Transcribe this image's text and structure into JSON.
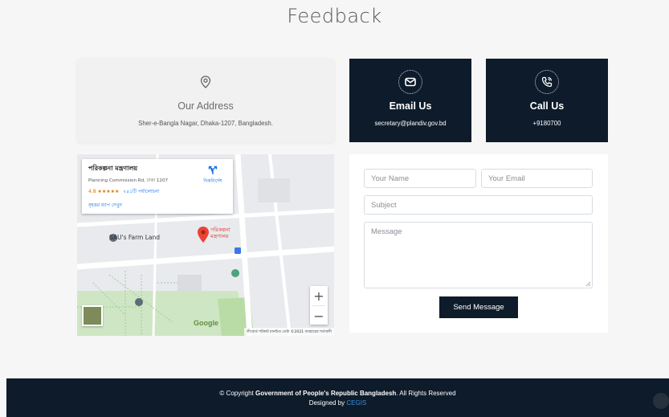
{
  "page": {
    "title": "Feedback"
  },
  "cards": {
    "address": {
      "title": "Our Address",
      "text": "Sher-e-Bangla Nagar, Dhaka-1207, Bangladesh.",
      "icon": "location-icon"
    },
    "email": {
      "title": "Email Us",
      "text": "secretary@plandiv.gov.bd",
      "icon": "envelope-icon"
    },
    "call": {
      "title": "Call Us",
      "text": "+9180700",
      "icon": "phone-icon"
    }
  },
  "map": {
    "place_name": "পরিকল্পনা মন্ত্রণালয়",
    "place_address": "Planning Commission Rd, ঢাকা 1207",
    "rating": "4.8",
    "stars": "★★★★★",
    "reviews": "২৪১টি পর্যালোচনা",
    "bigger_map": "বৃহত্তর ম্যাপ দেখুন",
    "directions": "দিকনির্দেশ",
    "pin_label": "পরিকল্পনা মন্ত্রণালয়",
    "farm_label": "SAU's Farm Land",
    "zoom_in": "+",
    "zoom_out": "−",
    "google": "Google",
    "attribution": "কীবোর্ড শর্টকাট   মানচিত্র ডেটা ©2021   ব্যবহারের শর্তাবলী"
  },
  "form": {
    "name_placeholder": "Your Name",
    "email_placeholder": "Your Email",
    "subject_placeholder": "Subject",
    "message_placeholder": "Message",
    "send_label": "Send Message"
  },
  "footer": {
    "copyright_prefix": "© Copyright",
    "org": "Government of People's Republic Bangladesh",
    "rights": ". All Rights Reserved",
    "designed_by": "Designed by",
    "designer": "CEGIS"
  },
  "colors": {
    "dark": "#0d1b2a",
    "link": "#3f8fd8"
  }
}
